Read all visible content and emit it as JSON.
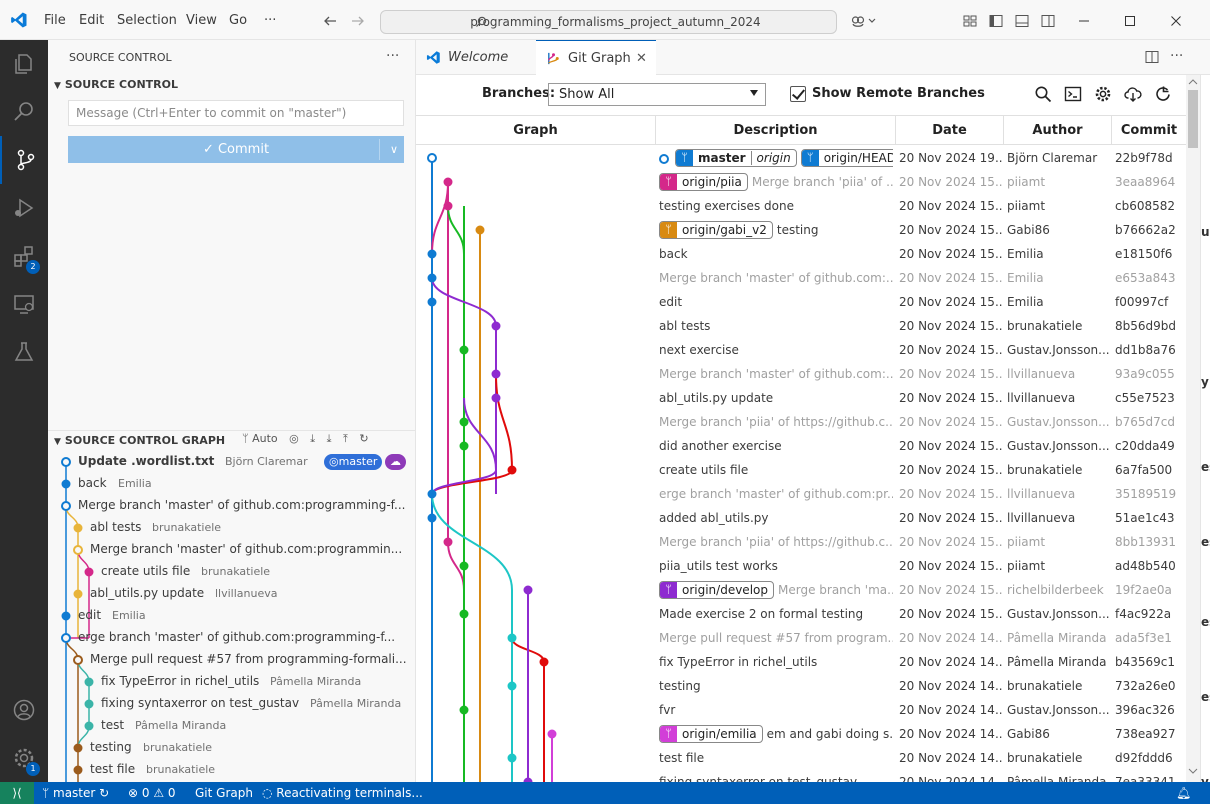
{
  "titlebar": {
    "menus": [
      "File",
      "Edit",
      "Selection",
      "View",
      "Go",
      "···"
    ],
    "search_text": "programming_formalisms_project_autumn_2024"
  },
  "activity": {
    "extensions_badge": "2",
    "settings_badge": "1"
  },
  "sidebar": {
    "title": "SOURCE CONTROL",
    "section": "SOURCE CONTROL",
    "message_placeholder": "Message (Ctrl+Enter to commit on \"master\")",
    "commit_label": "Commit",
    "graph_section": "SOURCE CONTROL GRAPH",
    "graph_auto": "Auto",
    "graph_rows": [
      {
        "msg": "Update .wordlist.txt",
        "author": "Björn Claremar",
        "bold": true,
        "pill": "master"
      },
      {
        "msg": "back",
        "author": "Emilia"
      },
      {
        "msg": "Merge branch 'master' of github.com:programming-f...",
        "author": ""
      },
      {
        "msg": "abl tests",
        "author": "brunakatiele"
      },
      {
        "msg": "Merge branch 'master' of github.com:programmin...",
        "author": ""
      },
      {
        "msg": "create utils file",
        "author": "brunakatiele"
      },
      {
        "msg": "abl_utils.py update",
        "author": "llvillanueva"
      },
      {
        "msg": "edit",
        "author": "Emilia"
      },
      {
        "msg": "erge branch 'master' of github.com:programming-f...",
        "author": ""
      },
      {
        "msg": "Merge pull request #57 from programming-formali...",
        "author": ""
      },
      {
        "msg": "fix TypeError in richel_utils",
        "author": "Pâmella Miranda"
      },
      {
        "msg": "fixing syntaxerror on test_gustav",
        "author": "Pâmella Miranda"
      },
      {
        "msg": "test",
        "author": "Pâmella Miranda"
      },
      {
        "msg": "testing",
        "author": "brunakatiele"
      },
      {
        "msg": "test file",
        "author": "brunakatiele"
      }
    ]
  },
  "tabs": [
    {
      "label": "Welcome"
    },
    {
      "label": "Git Graph"
    }
  ],
  "toolbar": {
    "branches_label": "Branches:",
    "branches_value": "Show All",
    "remote_label": "Show Remote Branches"
  },
  "table": {
    "headers": [
      "Graph",
      "Description",
      "Date",
      "Author",
      "Commit"
    ],
    "rows": [
      {
        "refs": [
          {
            "name": "master",
            "remote": "origin",
            "color": "#0f7bd2",
            "bold": true
          },
          {
            "name": "origin/HEAD",
            "color": "#0f7bd2"
          }
        ],
        "desc": "",
        "date": "20 Nov 2024 19...",
        "author": "Björn Claremar",
        "commit": "22b9f78d",
        "head": true
      },
      {
        "refs": [
          {
            "name": "origin/piia",
            "color": "#d4288a"
          }
        ],
        "desc": "Merge branch 'piia' of ...",
        "date": "20 Nov 2024 15...",
        "author": "piiamt",
        "commit": "3eaa8964",
        "dim": true
      },
      {
        "refs": [],
        "desc": "testing exercises done",
        "date": "20 Nov 2024 15...",
        "author": "piiamt",
        "commit": "cb608582"
      },
      {
        "refs": [
          {
            "name": "origin/gabi_v2",
            "color": "#d88a12"
          }
        ],
        "desc": "testing",
        "date": "20 Nov 2024 15...",
        "author": "Gabi86",
        "commit": "b76662a2"
      },
      {
        "refs": [],
        "desc": "back",
        "date": "20 Nov 2024 15...",
        "author": "Emilia",
        "commit": "e18150f6"
      },
      {
        "refs": [],
        "desc": "Merge branch 'master' of github.com:...",
        "date": "20 Nov 2024 15...",
        "author": "Emilia",
        "commit": "e653a843",
        "dim": true
      },
      {
        "refs": [],
        "desc": "edit",
        "date": "20 Nov 2024 15...",
        "author": "Emilia",
        "commit": "f00997cf"
      },
      {
        "refs": [],
        "desc": "abl tests",
        "date": "20 Nov 2024 15...",
        "author": "brunakatiele",
        "commit": "8b56d9bd"
      },
      {
        "refs": [],
        "desc": "next exercise",
        "date": "20 Nov 2024 15...",
        "author": "Gustav.Jonsson...",
        "commit": "dd1b8a76"
      },
      {
        "refs": [],
        "desc": "Merge branch 'master' of github.com:...",
        "date": "20 Nov 2024 15...",
        "author": "llvillanueva",
        "commit": "93a9c055",
        "dim": true
      },
      {
        "refs": [],
        "desc": "abl_utils.py update",
        "date": "20 Nov 2024 15...",
        "author": "llvillanueva",
        "commit": "c55e7523"
      },
      {
        "refs": [],
        "desc": "Merge branch 'piia' of https://github.c...",
        "date": "20 Nov 2024 15...",
        "author": "Gustav.Jonsson...",
        "commit": "b765d7cd",
        "dim": true
      },
      {
        "refs": [],
        "desc": "did another exercise",
        "date": "20 Nov 2024 15...",
        "author": "Gustav.Jonsson...",
        "commit": "c20dda49"
      },
      {
        "refs": [],
        "desc": "create utils file",
        "date": "20 Nov 2024 15...",
        "author": "brunakatiele",
        "commit": "6a7fa500"
      },
      {
        "refs": [],
        "desc": "erge branch 'master' of github.com:pr...",
        "date": "20 Nov 2024 15...",
        "author": "llvillanueva",
        "commit": "35189519",
        "dim": true
      },
      {
        "refs": [],
        "desc": "added abl_utils.py",
        "date": "20 Nov 2024 15...",
        "author": "llvillanueva",
        "commit": "51ae1c43"
      },
      {
        "refs": [],
        "desc": "Merge branch 'piia' of https://github.c...",
        "date": "20 Nov 2024 15...",
        "author": "piiamt",
        "commit": "8bb13931",
        "dim": true
      },
      {
        "refs": [],
        "desc": "piia_utils test works",
        "date": "20 Nov 2024 15...",
        "author": "piiamt",
        "commit": "ad48b540"
      },
      {
        "refs": [
          {
            "name": "origin/develop",
            "color": "#8e2bd0"
          }
        ],
        "desc": "Merge branch 'ma...",
        "date": "20 Nov 2024 15...",
        "author": "richelbilderbeek",
        "commit": "19f2ae0a",
        "dim": true
      },
      {
        "refs": [],
        "desc": "Made exercise 2 on formal testing",
        "date": "20 Nov 2024 15...",
        "author": "Gustav.Jonsson...",
        "commit": "f4ac922a"
      },
      {
        "refs": [],
        "desc": "Merge pull request #57 from program...",
        "date": "20 Nov 2024 14...",
        "author": "Pâmella Miranda",
        "commit": "ada5f3e1",
        "dim": true
      },
      {
        "refs": [],
        "desc": "fix TypeError in richel_utils",
        "date": "20 Nov 2024 14...",
        "author": "Pâmella Miranda",
        "commit": "b43569c1"
      },
      {
        "refs": [],
        "desc": "testing",
        "date": "20 Nov 2024 14...",
        "author": "brunakatiele",
        "commit": "732a26e0"
      },
      {
        "refs": [],
        "desc": "fvr",
        "date": "20 Nov 2024 14...",
        "author": "Gustav.Jonsson...",
        "commit": "396ac326"
      },
      {
        "refs": [
          {
            "name": "origin/emilia",
            "color": "#d23fd8"
          }
        ],
        "desc": "em and gabi doing s...",
        "date": "20 Nov 2024 14...",
        "author": "Gabi86",
        "commit": "738ea927"
      },
      {
        "refs": [],
        "desc": "test file",
        "date": "20 Nov 2024 14...",
        "author": "brunakatiele",
        "commit": "d92fddd6"
      },
      {
        "refs": [],
        "desc": "fixing syntaxerror on test_gustav",
        "date": "20 Nov 2024 14...",
        "author": "Pâmella Miranda",
        "commit": "7ea33341"
      }
    ]
  },
  "rightstrip": [
    "ul",
    "y",
    "es",
    "es",
    "es",
    "es",
    "y"
  ],
  "statusbar": {
    "branch": "master",
    "problems": "⊗ 0 ⚠ 0",
    "gitgraph": "Git Graph",
    "activity": "Reactivating terminals..."
  }
}
